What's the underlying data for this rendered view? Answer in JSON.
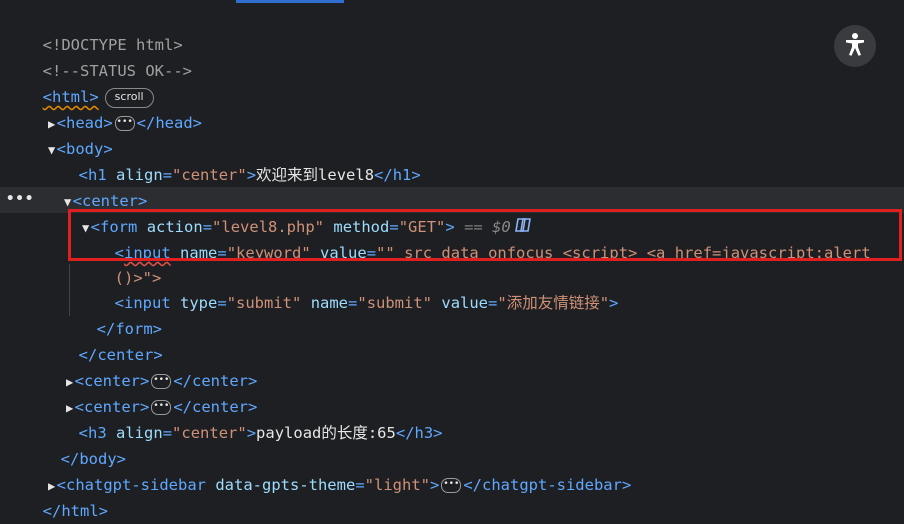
{
  "lines": {
    "doctype": "<!DOCTYPE html>",
    "comment": "<!--STATUS OK-->",
    "html_open": "<html>",
    "scroll_badge": "scroll",
    "head_open": "<head>",
    "head_close": "</head>",
    "body_open": "<body>",
    "h1_open": "<h1",
    "h1_attr": "align",
    "h1_val": "\"center\"",
    "h1_gt": ">",
    "h1_text": "欢迎来到level8",
    "h1_close": "</h1>",
    "center_open": "<center>",
    "form_open": "<form",
    "form_action_attr": "action",
    "form_action_val": "\"level8.php\"",
    "form_method_attr": "method",
    "form_method_val": "\"GET\"",
    "form_gt": ">",
    "form_eq": "==",
    "form_dollar": "$0",
    "input1_lt": "<",
    "input1_tag": "input",
    "input1_name_attr": "name",
    "input1_name_val": "\"keyword\"",
    "input1_value_attr": "value",
    "input1_value_val_a": "\"\"",
    "input1_rest": "src data onfocus <script> <a href=javascript:alert",
    "input1_cont": "()>\">",
    "input2_open": "<input",
    "input2_type_attr": "type",
    "input2_type_val": "\"submit\"",
    "input2_name_attr": "name",
    "input2_name_val": "\"submit\"",
    "input2_value_attr": "value",
    "input2_value_val": "\"添加友情链接\"",
    "input2_gt": ">",
    "form_close": "</form>",
    "center_close": "</center>",
    "h3_open": "<h3",
    "h3_attr": "align",
    "h3_val": "\"center\"",
    "h3_gt": ">",
    "h3_text": "payload的长度:65",
    "h3_close": "</h3>",
    "body_close": "</body>",
    "sidebar_open": "<chatgpt-sidebar",
    "sidebar_attr": "data-gpts-theme",
    "sidebar_val": "\"light\"",
    "sidebar_gt": ">",
    "sidebar_close": "</chatgpt-sidebar>",
    "html_close": "</html>",
    "ellipsis": "•••",
    "row_dots": "•••"
  },
  "icons": {
    "accessibility": "accessibility-person-icon",
    "copilot": "copilot-icon"
  },
  "colors": {
    "background": "#1e1f22",
    "tag": "#5fa8ff",
    "attribute": "#9cdcfe",
    "value": "#ce9178",
    "highlight_box": "#e02020"
  }
}
